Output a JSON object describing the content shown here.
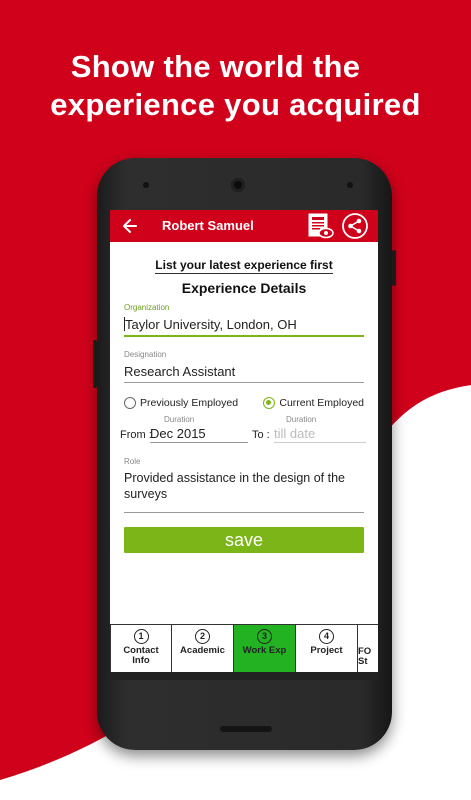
{
  "headline": {
    "line1": "Show the world the",
    "line2": "experience you acquired"
  },
  "topbar": {
    "title": "Robert Samuel",
    "icons": [
      "back-arrow-icon",
      "resume-preview-icon",
      "share-icon"
    ]
  },
  "form": {
    "tip": "List your latest experience first",
    "section_title": "Experience Details",
    "organization": {
      "label": "Organization",
      "value": "Taylor University, London, OH"
    },
    "designation": {
      "label": "Designation",
      "value": "Research Assistant"
    },
    "employment": {
      "options": [
        "Previously Employed",
        "Current Employed"
      ],
      "selected": "Current Employed"
    },
    "from": {
      "label": "From :",
      "duration_label": "Duration",
      "value": "Dec 2015"
    },
    "to": {
      "label": "To :",
      "duration_label": "Duration",
      "placeholder": "till date"
    },
    "role": {
      "label": "Role",
      "value": "Provided assistance in the design of the surveys"
    },
    "save_label": "save"
  },
  "tabs": [
    {
      "num": "1",
      "label": "Contact Info",
      "active": false
    },
    {
      "num": "2",
      "label": "Academic",
      "active": false
    },
    {
      "num": "3",
      "label": "Work Exp",
      "active": true
    },
    {
      "num": "4",
      "label": "Project",
      "active": false
    },
    {
      "num": "",
      "label": "FO St",
      "active": false
    }
  ],
  "colors": {
    "brand_red": "#d0021b",
    "accent_green": "#7cb518",
    "active_tab_green": "#22b222"
  }
}
